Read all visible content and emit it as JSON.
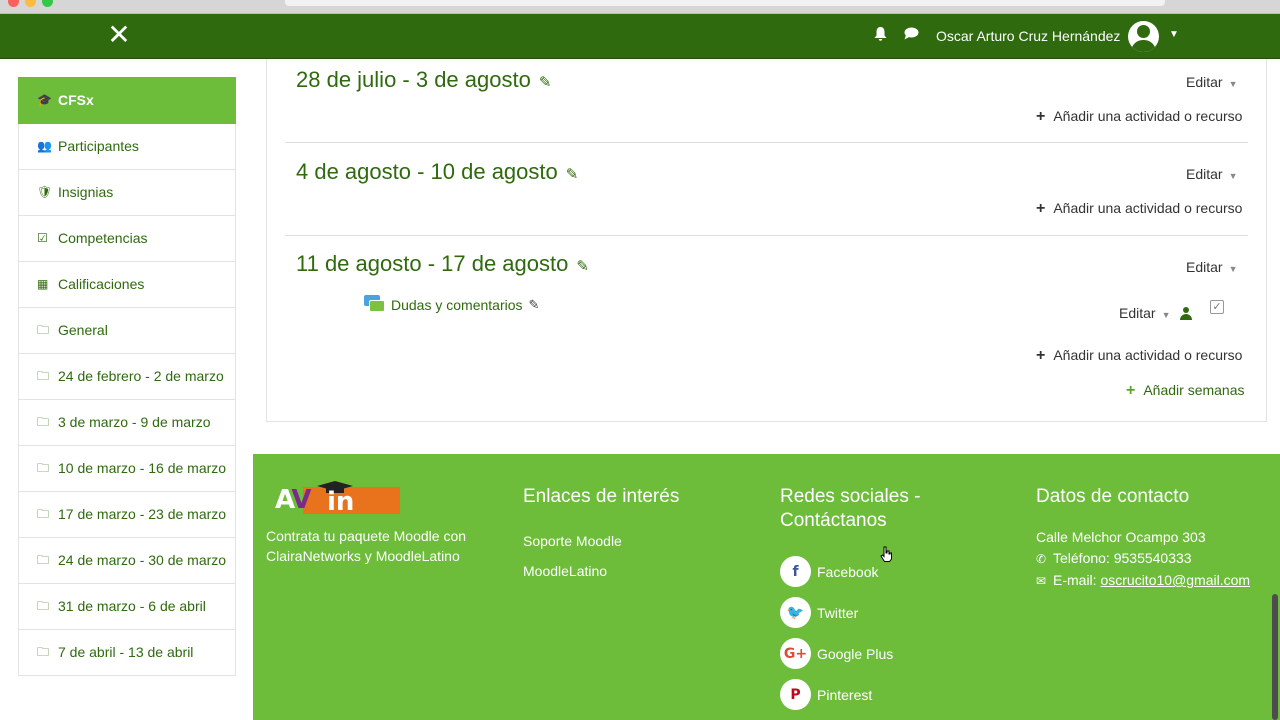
{
  "navbar": {
    "close_icon": "close-icon",
    "user_name": "Oscar Arturo Cruz Hernández",
    "bell_icon": "bell-icon",
    "messages_icon": "chat-bubble-icon"
  },
  "sidebar": {
    "items": [
      {
        "label": "CFSx",
        "icon": "graduation-cap-icon",
        "glyph": "🎓"
      },
      {
        "label": "Participantes",
        "icon": "users-icon",
        "glyph": "👥"
      },
      {
        "label": "Insignias",
        "icon": "shield-icon",
        "glyph": "🛡"
      },
      {
        "label": "Competencias",
        "icon": "checkbox-icon",
        "glyph": "☑"
      },
      {
        "label": "Calificaciones",
        "icon": "table-icon",
        "glyph": "▦"
      },
      {
        "label": "General",
        "icon": "folder-icon",
        "glyph": "🗀"
      },
      {
        "label": "24 de febrero - 2 de marzo",
        "icon": "folder-icon",
        "glyph": "🗀"
      },
      {
        "label": "3 de marzo - 9 de marzo",
        "icon": "folder-icon",
        "glyph": "🗀"
      },
      {
        "label": "10 de marzo - 16 de marzo",
        "icon": "folder-icon",
        "glyph": "🗀"
      },
      {
        "label": "17 de marzo - 23 de marzo",
        "icon": "folder-icon",
        "glyph": "🗀"
      },
      {
        "label": "24 de marzo - 30 de marzo",
        "icon": "folder-icon",
        "glyph": "🗀"
      },
      {
        "label": "31 de marzo - 6 de abril",
        "icon": "folder-icon",
        "glyph": "🗀"
      },
      {
        "label": "7 de abril - 13 de abril",
        "icon": "folder-icon",
        "glyph": "🗀"
      }
    ]
  },
  "main": {
    "sections": [
      {
        "title": "28 de julio - 3 de agosto",
        "edit_label": "Editar",
        "add_label": "Añadir una actividad o recurso"
      },
      {
        "title": "4 de agosto - 10 de agosto",
        "edit_label": "Editar",
        "add_label": "Añadir una actividad o recurso"
      },
      {
        "title": "11 de agosto - 17 de agosto",
        "edit_label": "Editar",
        "add_label": "Añadir una actividad o recurso"
      }
    ],
    "activity": {
      "label": "Dudas y comentarios",
      "edit_label": "Editar"
    },
    "add_weeks_label": "Añadir semanas"
  },
  "footer": {
    "logo_text_a": "A",
    "logo_text_v": "V",
    "logo_text_in": "in",
    "tagline": "Contrata tu paquete Moodle con ClairaNetworks y MoodleLatino",
    "links_heading": "Enlaces de interés",
    "links": [
      "Soporte Moodle",
      "MoodleLatino"
    ],
    "social_heading": "Redes sociales - Contáctanos",
    "social": [
      {
        "label": "Facebook",
        "icon": "facebook-icon",
        "glyph": "f",
        "color": "#3b5998"
      },
      {
        "label": "Twitter",
        "icon": "twitter-icon",
        "glyph": "🐦",
        "color": "#1da1f2"
      },
      {
        "label": "Google Plus",
        "icon": "google-plus-icon",
        "glyph": "G+",
        "color": "#dd4b39"
      },
      {
        "label": "Pinterest",
        "icon": "pinterest-icon",
        "glyph": "P",
        "color": "#bd081c"
      }
    ],
    "contact_heading": "Datos de contacto",
    "address": "Calle Melchor Ocampo 303",
    "phone": "Teléfono: 9535540333",
    "email_label": "E-mail:",
    "email": "oscrucito10@gmail.com"
  },
  "colors": {
    "navbar_green": "#2f6a0f",
    "accent_green": "#6dbd3b",
    "link_green": "#2f6a0f"
  }
}
